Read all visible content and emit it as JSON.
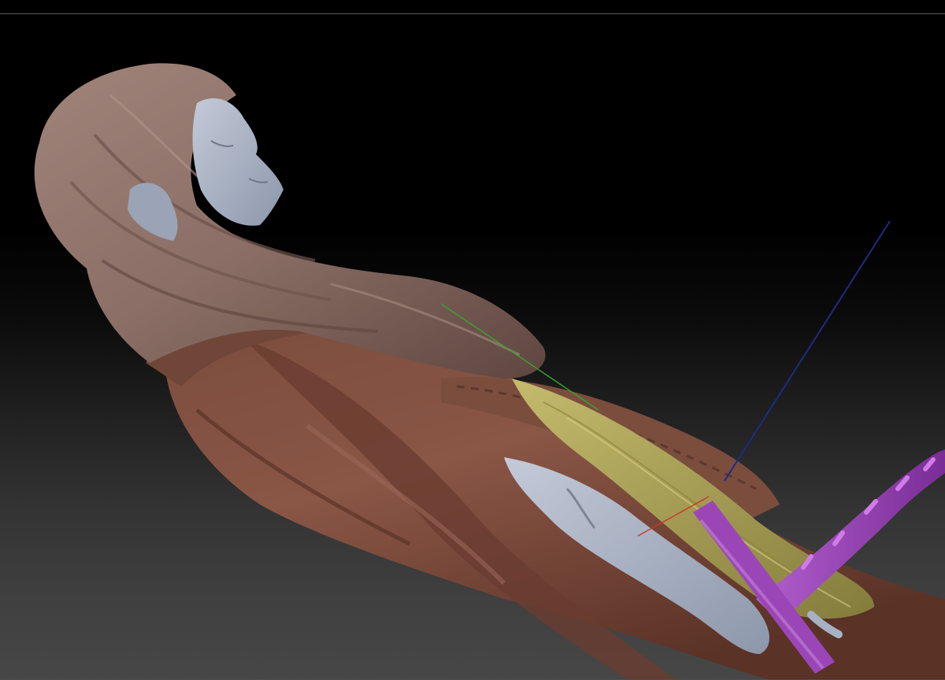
{
  "window": {
    "title": ""
  },
  "viewport": {
    "background_top": "#000000",
    "background_bottom": "#474747",
    "border_color": "#5a5a5a"
  },
  "model": {
    "hair_color": "#8b6f66",
    "skin_color": "#a8b1c3",
    "cloak_color": "#7c4a3a",
    "sash_color": "#a79f58",
    "sword_color": "#9b46b7"
  },
  "gizmo": {
    "x_axis_color": "#c83a2a",
    "y_axis_color": "#3aa02f",
    "z_axis_color": "#1f2a86"
  }
}
